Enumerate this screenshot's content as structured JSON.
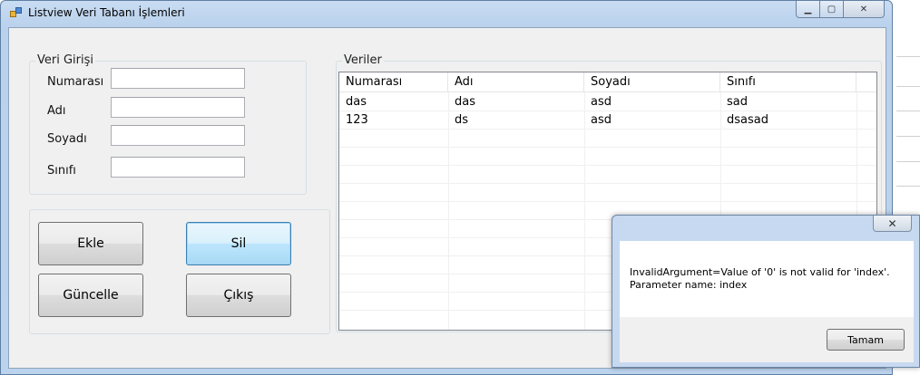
{
  "window": {
    "title": "Listview Veri Tabanı İşlemleri",
    "min_glyph": "▁",
    "max_glyph": "▢",
    "close_glyph": "✕"
  },
  "input_group": {
    "title": "Veri Girişi",
    "fields": [
      {
        "label": "Numarası",
        "value": ""
      },
      {
        "label": "Adı",
        "value": ""
      },
      {
        "label": "Soyadı",
        "value": ""
      },
      {
        "label": "Sınıfı",
        "value": ""
      }
    ]
  },
  "buttons": {
    "add": "Ekle",
    "delete": "Sil",
    "update": "Güncelle",
    "exit": "Çıkış"
  },
  "list_group": {
    "title": "Veriler",
    "columns": [
      "Numarası",
      "Adı",
      "Soyadı",
      "Sınıfı"
    ],
    "rows": [
      [
        "das",
        "das",
        "asd",
        "sad"
      ],
      [
        "123",
        "ds",
        "asd",
        "dsasad"
      ]
    ]
  },
  "message_box": {
    "line1": "InvalidArgument=Value of '0' is not valid for 'index'.",
    "line2": "Parameter name: index",
    "ok_label": "Tamam",
    "close_glyph": "✕"
  },
  "colors": {
    "title_bar": "#b9d1ec",
    "client_bg": "#f0f0f0",
    "focus_border": "#3c7fb1"
  }
}
